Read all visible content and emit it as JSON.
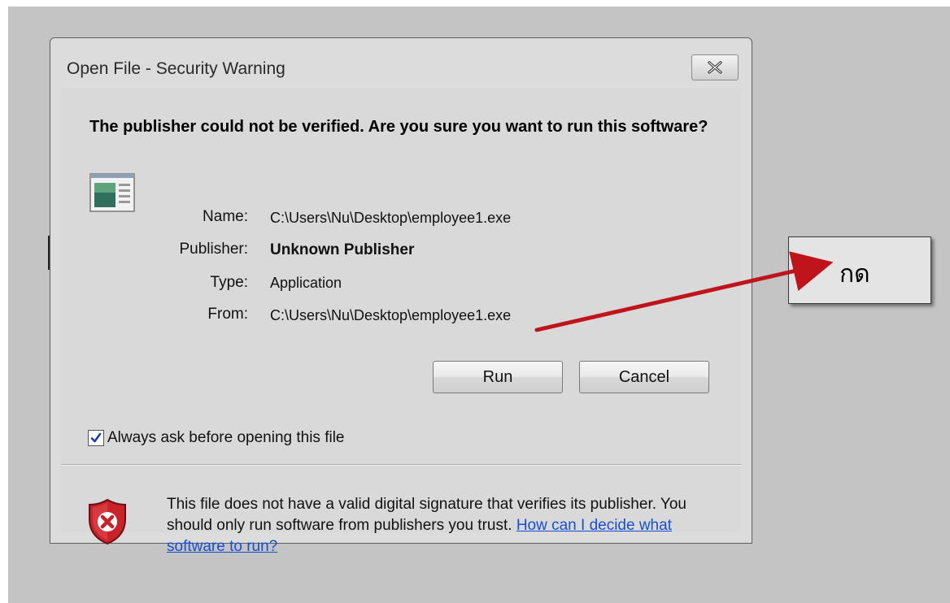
{
  "window": {
    "title": "Open File - Security Warning",
    "close_label": "✕"
  },
  "dialog": {
    "headline": "The publisher could not be verified.  Are you sure you want to run this software?",
    "fields": [
      {
        "label": "Name:",
        "value": "C:\\Users\\Nu\\Desktop\\employee1.exe"
      },
      {
        "label": "Publisher:",
        "value": "Unknown Publisher"
      },
      {
        "label": "Type:",
        "value": "Application"
      },
      {
        "label": "From:",
        "value": "C:\\Users\\Nu\\Desktop\\employee1.exe"
      }
    ],
    "run_label": "Run",
    "cancel_label": "Cancel",
    "always_ask_label": "Always ask before opening this file",
    "always_ask_checked": true,
    "warning_text": "This file does not have a valid digital signature that verifies its publisher. You should only run software from publishers you trust.",
    "warning_link": "How can I decide what software to run?"
  },
  "annotation": {
    "callout_text": "กด",
    "arrow_color": "#c0141c"
  },
  "icons": {
    "file": "application-file-icon",
    "shield": "security-shield-icon",
    "close": "close-icon",
    "check": "checkmark-icon"
  }
}
